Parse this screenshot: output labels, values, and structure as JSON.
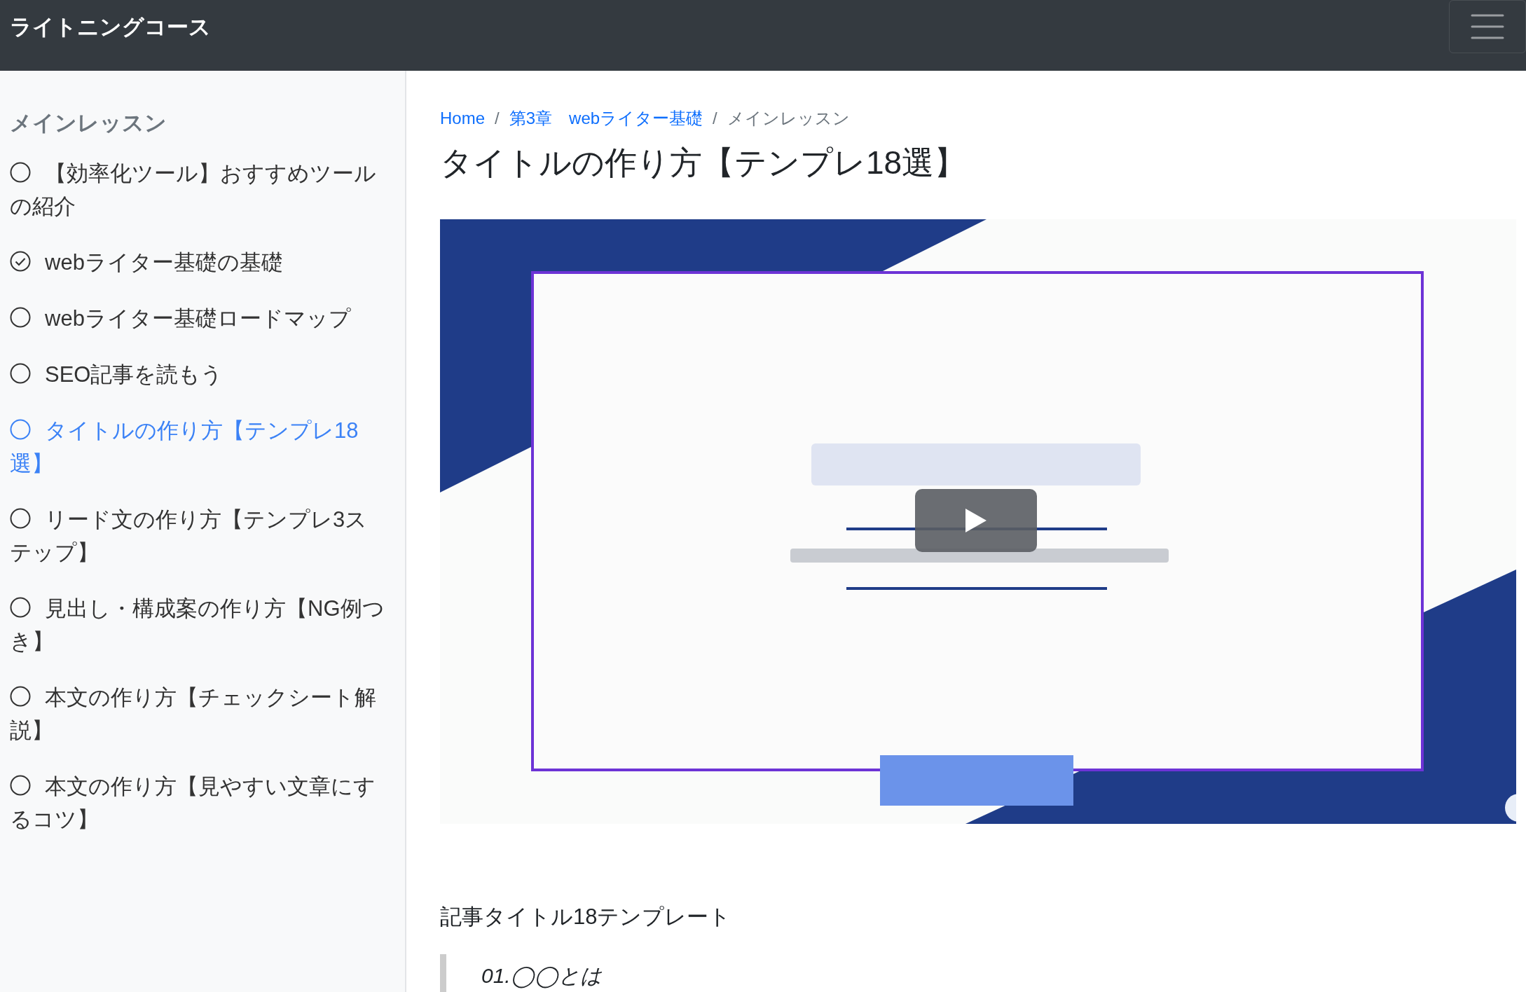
{
  "navbar": {
    "brand": "ライトニングコース"
  },
  "sidebar": {
    "heading": "メインレッスン",
    "lessons": [
      {
        "title": "【効率化ツール】おすすめツールの紹介",
        "checked": false,
        "selected": false
      },
      {
        "title": "webライター基礎の基礎",
        "checked": true,
        "selected": false
      },
      {
        "title": "webライター基礎ロードマップ",
        "checked": false,
        "selected": false
      },
      {
        "title": "SEO記事を読もう",
        "checked": false,
        "selected": false
      },
      {
        "title": "タイトルの作り方【テンプレ18選】",
        "checked": false,
        "selected": true
      },
      {
        "title": "リード文の作り方【テンプレ3ステップ】",
        "checked": false,
        "selected": false
      },
      {
        "title": "見出し・構成案の作り方【NG例つき】",
        "checked": false,
        "selected": false
      },
      {
        "title": "本文の作り方【チェックシート解説】",
        "checked": false,
        "selected": false
      },
      {
        "title": "本文の作り方【見やすい文章にするコツ】",
        "checked": false,
        "selected": false
      }
    ]
  },
  "breadcrumb": [
    {
      "label": "Home",
      "kind": "link"
    },
    {
      "separator": "/",
      "label": "第3章　webライター基礎",
      "kind": "link"
    },
    {
      "separator": "/",
      "label": "メインレッスン",
      "kind": "current"
    }
  ],
  "page_title": "タイトルの作り方【テンプレ18選】",
  "section_heading": "記事タイトル18テンプレート",
  "quote": "01.◯◯とは"
}
